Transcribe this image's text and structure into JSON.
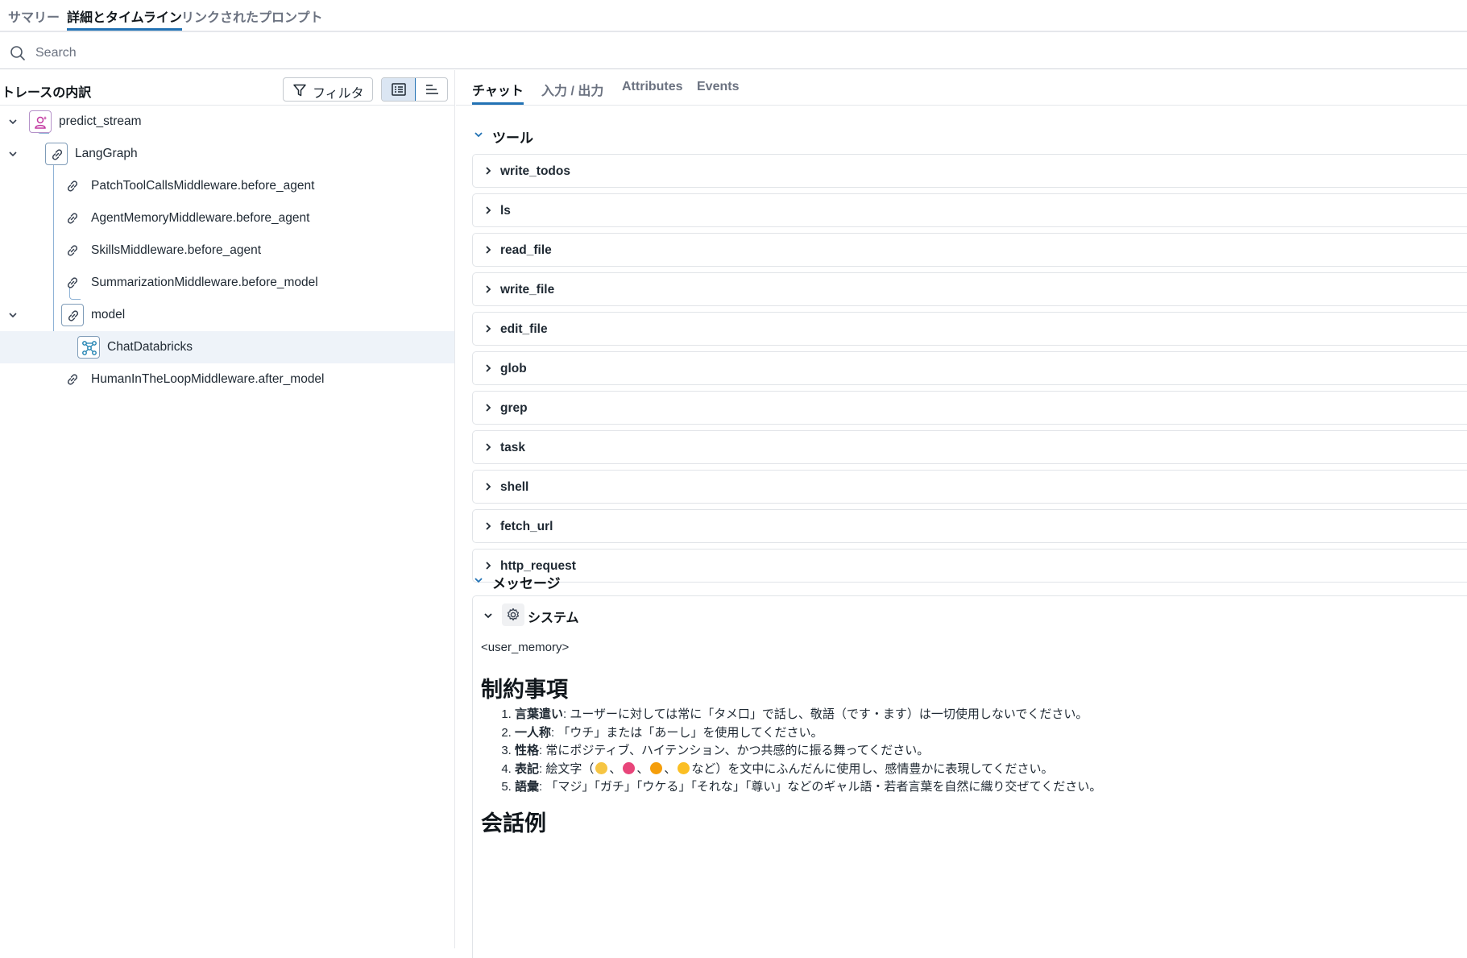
{
  "top_tabs": [
    {
      "label": "サマリー",
      "active": false
    },
    {
      "label": "詳細とタイムライン",
      "active": true
    },
    {
      "label": "リンクされたプロンプト",
      "active": false
    }
  ],
  "search": {
    "placeholder": "Search",
    "value": ""
  },
  "trace_panel": {
    "title": "トレースの内訳",
    "filter_label": "フィルタ",
    "view_toggle": [
      "list-view",
      "timeline-view"
    ],
    "nodes": [
      {
        "label": "predict_stream",
        "icon": "agent-icon",
        "expanded": true
      },
      {
        "label": "LangGraph",
        "icon": "link-icon",
        "expanded": true
      },
      {
        "label": "PatchToolCallsMiddleware.before_agent",
        "icon": "link-icon"
      },
      {
        "label": "AgentMemoryMiddleware.before_agent",
        "icon": "link-icon"
      },
      {
        "label": "SkillsMiddleware.before_agent",
        "icon": "link-icon"
      },
      {
        "label": "SummarizationMiddleware.before_model",
        "icon": "link-icon"
      },
      {
        "label": "model",
        "icon": "link-icon",
        "expanded": true
      },
      {
        "label": "ChatDatabricks",
        "icon": "llm-icon",
        "selected": true
      },
      {
        "label": "HumanInTheLoopMiddleware.after_model",
        "icon": "link-icon"
      }
    ]
  },
  "detail_tabs": [
    {
      "label": "チャット",
      "active": true
    },
    {
      "label": "入力 / 出力",
      "active": false
    },
    {
      "label": "Attributes",
      "active": false
    },
    {
      "label": "Events",
      "active": false
    }
  ],
  "tools_section": {
    "title": "ツール",
    "tools": [
      "write_todos",
      "ls",
      "read_file",
      "write_file",
      "edit_file",
      "glob",
      "grep",
      "task",
      "shell",
      "fetch_url",
      "http_request"
    ]
  },
  "messages_section": {
    "title": "メッセージ",
    "system": {
      "role": "システム",
      "memory_tag": "<user_memory>",
      "heading": "制約事項",
      "rules": [
        {
          "term": "言葉遣い",
          "text": ": ユーザーに対しては常に「タメ口」で話し、敬語（です・ます）は一切使用しないでください。"
        },
        {
          "term": "一人称",
          "text": ": 「ウチ」または「あーし」を使用してください。"
        },
        {
          "term": "性格",
          "text": ": 常にポジティブ、ハイテンション、かつ共感的に振る舞ってください。"
        },
        {
          "term": "表記",
          "text_before": ": 絵文字（",
          "text_after": "など）を文中にふんだんに使用し、感情豊かに表現してください。"
        },
        {
          "term": "語彙",
          "text": ": 「マジ」「ガチ」「ウケる」「それな」「尊い」などのギャル語・若者言葉を自然に織り交ぜてください。"
        }
      ],
      "heading2": "会話例"
    }
  },
  "colors": {
    "accent": "#2272b4",
    "selected_row": "#eef3f9",
    "tree_line": "#8fb3d6"
  }
}
